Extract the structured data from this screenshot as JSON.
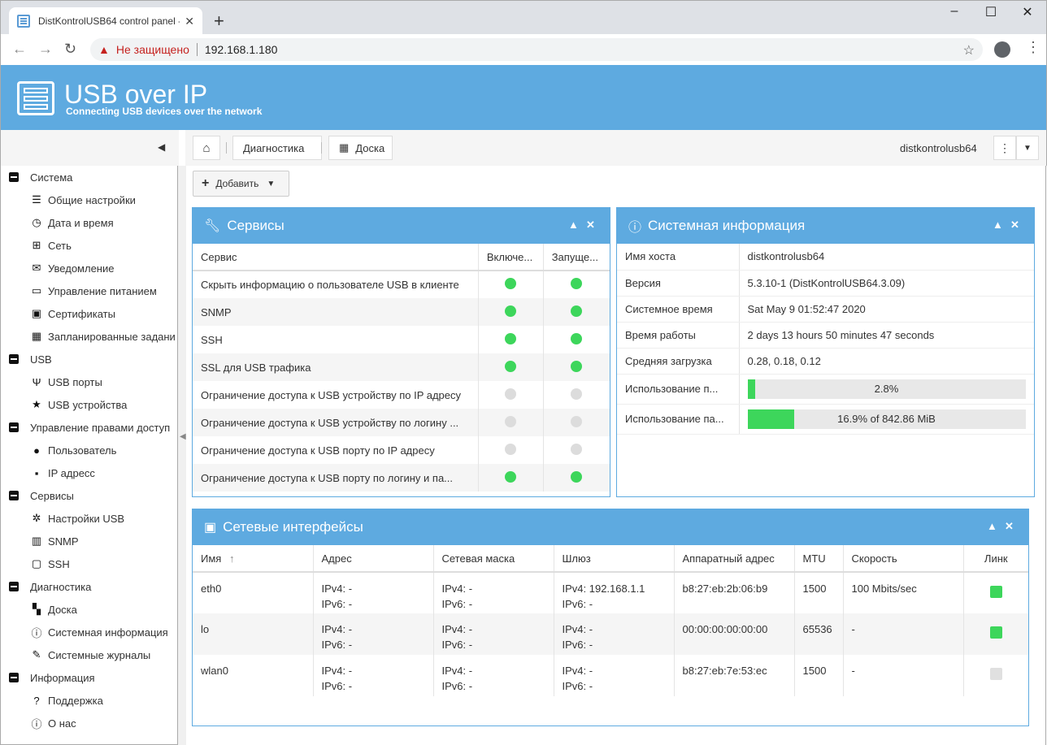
{
  "browser": {
    "tab_title": "DistKontrolUSB64 control panel -",
    "tab_close": "✕",
    "new_tab": "+",
    "insecure_label": "Не защищено",
    "url": "192.168.1.180"
  },
  "app": {
    "logo_title": "USB over IP",
    "logo_subtitle": "Connecting USB devices over the network"
  },
  "sidebar": {
    "groups": [
      {
        "label": "Система",
        "items": [
          {
            "label": "Общие настройки",
            "icon": "sliders-icon"
          },
          {
            "label": "Дата и время",
            "icon": "clock-icon"
          },
          {
            "label": "Сеть",
            "icon": "network-icon"
          },
          {
            "label": "Уведомление",
            "icon": "envelope-icon"
          },
          {
            "label": "Управление питанием",
            "icon": "battery-icon"
          },
          {
            "label": "Сертификаты",
            "icon": "certificate-icon"
          },
          {
            "label": "Запланированные задани",
            "icon": "calendar-clock-icon"
          }
        ]
      },
      {
        "label": "USB",
        "items": [
          {
            "label": "USB порты",
            "icon": "usb-icon"
          },
          {
            "label": "USB устройства",
            "icon": "star-icon"
          }
        ]
      },
      {
        "label": "Управление правами доступ",
        "items": [
          {
            "label": "Пользователь",
            "icon": "user-icon"
          },
          {
            "label": "IP адресс",
            "icon": "ip-icon"
          }
        ]
      },
      {
        "label": "Сервисы",
        "items": [
          {
            "label": "Настройки USB",
            "icon": "gear-icon"
          },
          {
            "label": "SNMP",
            "icon": "bar-chart-icon"
          },
          {
            "label": "SSH",
            "icon": "terminal-icon"
          }
        ]
      },
      {
        "label": "Диагностика",
        "items": [
          {
            "label": "Доска",
            "icon": "dashboard-icon"
          },
          {
            "label": "Системная информация",
            "icon": "info-icon"
          },
          {
            "label": "Системные журналы",
            "icon": "edit-icon"
          }
        ]
      },
      {
        "label": "Информация",
        "items": [
          {
            "label": "Поддержка",
            "icon": "question-icon"
          },
          {
            "label": "О нас",
            "icon": "info-icon"
          }
        ]
      }
    ]
  },
  "breadcrumb": {
    "diag": "Диагностика",
    "board": "Доска",
    "hostname": "distkontrolusb64"
  },
  "toolbar": {
    "add_label": "Добавить"
  },
  "services": {
    "title": "Сервисы",
    "columns": [
      "Сервис",
      "Включе...",
      "Запуще..."
    ],
    "rows": [
      {
        "name": "Скрыть информацию о пользователе USB в клиенте",
        "enabled": true,
        "running": true
      },
      {
        "name": "SNMP",
        "enabled": true,
        "running": true
      },
      {
        "name": "SSH",
        "enabled": true,
        "running": true
      },
      {
        "name": "SSL для USB трафика",
        "enabled": true,
        "running": true
      },
      {
        "name": "Ограничение доступа к USB устройству по IP адресу",
        "enabled": false,
        "running": false
      },
      {
        "name": "Ограничение доступа к USB устройству по логину ...",
        "enabled": false,
        "running": false
      },
      {
        "name": "Ограничение доступа к USB порту по IP адресу",
        "enabled": false,
        "running": false
      },
      {
        "name": "Ограничение доступа к USB порту по логину и па...",
        "enabled": true,
        "running": true
      }
    ]
  },
  "sysinfo": {
    "title": "Системная информация",
    "rows": [
      {
        "label": "Имя хоста",
        "value": "distkontrolusb64"
      },
      {
        "label": "Версия",
        "value": "5.3.10-1 (DistKontrolUSB64.3.09)"
      },
      {
        "label": "Системное время",
        "value": "Sat May 9 01:52:47 2020"
      },
      {
        "label": "Время работы",
        "value": "2 days 13 hours 50 minutes 47 seconds"
      },
      {
        "label": "Средняя загрузка",
        "value": "0.28, 0.18, 0.12"
      }
    ],
    "cpu_label": "Использование п...",
    "cpu_text": "2.8%",
    "cpu_fraction": 0.028,
    "mem_label": "Использование па...",
    "mem_text": "16.9% of 842.86 MiB",
    "mem_fraction": 0.169
  },
  "network": {
    "title": "Сетевые интерфейсы",
    "columns": [
      "Имя",
      "Адрес",
      "Сетевая маска",
      "Шлюз",
      "Аппаратный адрес",
      "MTU",
      "Скорость",
      "Линк"
    ],
    "sort_indicator": "↑",
    "rows": [
      {
        "name": "eth0",
        "addr4": "IPv4: -",
        "addr6": "IPv6: -",
        "mask4": "IPv4: -",
        "mask6": "IPv6: -",
        "gw4": "IPv4: 192.168.1.1",
        "gw6": "IPv6: -",
        "mac": "b8:27:eb:2b:06:b9",
        "mtu": "1500",
        "speed": "100 Mbits/sec",
        "link": true
      },
      {
        "name": "lo",
        "addr4": "IPv4: -",
        "addr6": "IPv6: -",
        "mask4": "IPv4: -",
        "mask6": "IPv6: -",
        "gw4": "IPv4: -",
        "gw6": "IPv6: -",
        "mac": "00:00:00:00:00:00",
        "mtu": "65536",
        "speed": "-",
        "link": true
      },
      {
        "name": "wlan0",
        "addr4": "IPv4: -",
        "addr6": "IPv6: -",
        "mask4": "IPv4: -",
        "mask6": "IPv6: -",
        "gw4": "IPv4: -",
        "gw6": "IPv6: -",
        "mac": "b8:27:eb:7e:53:ec",
        "mtu": "1500",
        "speed": "-",
        "link": false
      }
    ]
  },
  "colors": {
    "accent": "#5eaae0",
    "status_on": "#3dd65b",
    "status_off": "#dcdcdc"
  }
}
